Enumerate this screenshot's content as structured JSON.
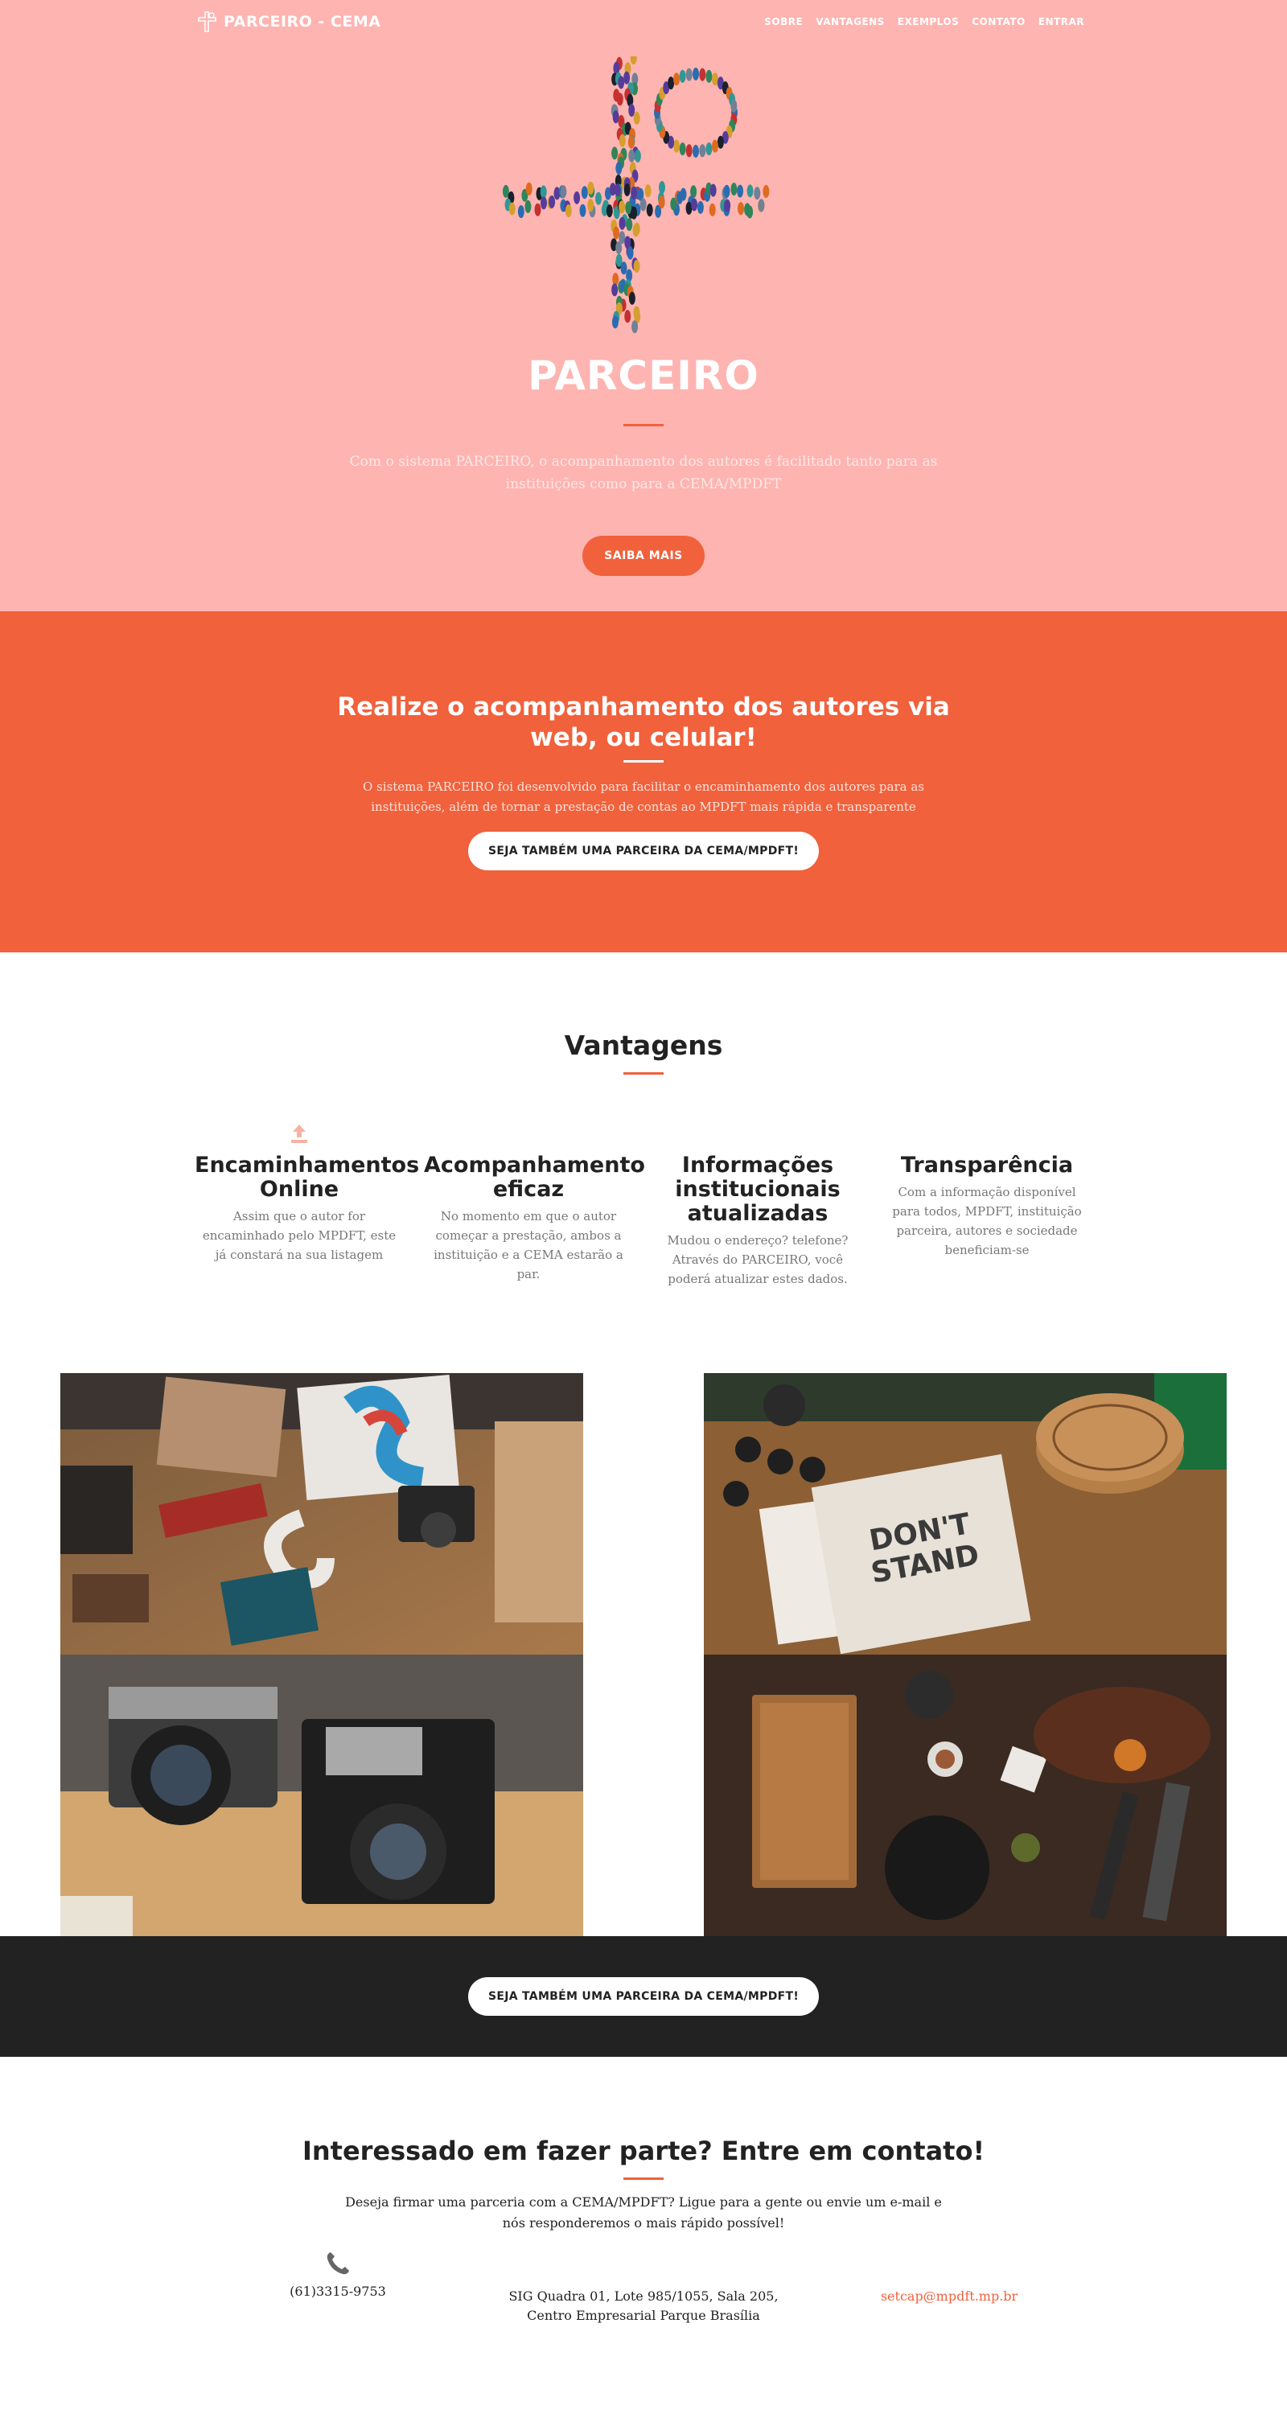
{
  "nav": {
    "brand": "PARCEIRO - CEMA",
    "links": [
      "SOBRE",
      "VANTAGENS",
      "EXEMPLOS",
      "CONTATO",
      "ENTRAR"
    ]
  },
  "hero": {
    "title": "PARCEIRO",
    "text": "Com o sistema PARCEIRO, o acompanhamento dos autores é facilitado tanto para as instituições como para a CEMA/MPDFT",
    "button": "SAIBA MAIS"
  },
  "about": {
    "title": "Realize o acompanhamento dos autores via web, ou celular!",
    "text": "O sistema PARCEIRO foi desenvolvido para facilitar o encaminhamento dos autores para as instituições, além de tornar a prestação de contas ao MPDFT mais rápida e transparente",
    "button": "SEJA TAMBÉM UMA PARCEIRA DA CEMA/MPDFT!"
  },
  "services": {
    "title": "Vantagens",
    "items": [
      {
        "title": "Encaminhamentos Online",
        "text": "Assim que o autor for encaminhado pelo MPDFT, este já constará na sua listagem",
        "icon": "upload-icon"
      },
      {
        "title": "Acompanhamento eficaz",
        "text": "No momento em que o autor começar a prestação, ambos a instituição e a CEMA estarão a par.",
        "icon": "none"
      },
      {
        "title": "Informações institucionais atualizadas",
        "text": "Mudou o endereço? telefone? Através do PARCEIRO, você poderá atualizar estes dados.",
        "icon": "none"
      },
      {
        "title": "Transparência",
        "text": "Com a informação disponível para todos, MPDFT, instituição parceira, autores e sociedade beneficiam-se",
        "icon": "none"
      }
    ]
  },
  "cta": {
    "button": "SEJA TAMBÉM UMA PARCEIRA DA CEMA/MPDFT!"
  },
  "contact": {
    "title": "Interessado em fazer parte? Entre em contato!",
    "text": "Deseja firmar uma parceria com a CEMA/MPDFT? Ligue para a gente ou envie um e-mail e nós responderemos o mais rápido possível!",
    "phone": "(61)3315-9753",
    "address_line1": "SIG Quadra 01, Lote 985/1055, Sala 205,",
    "address_line2": "Centro Empresarial Parque Brasília",
    "email": "setcap@mpdft.mp.br"
  },
  "colors": {
    "hero_bg": "#feb4b1",
    "accent": "#f0613c",
    "dark": "#222222"
  }
}
